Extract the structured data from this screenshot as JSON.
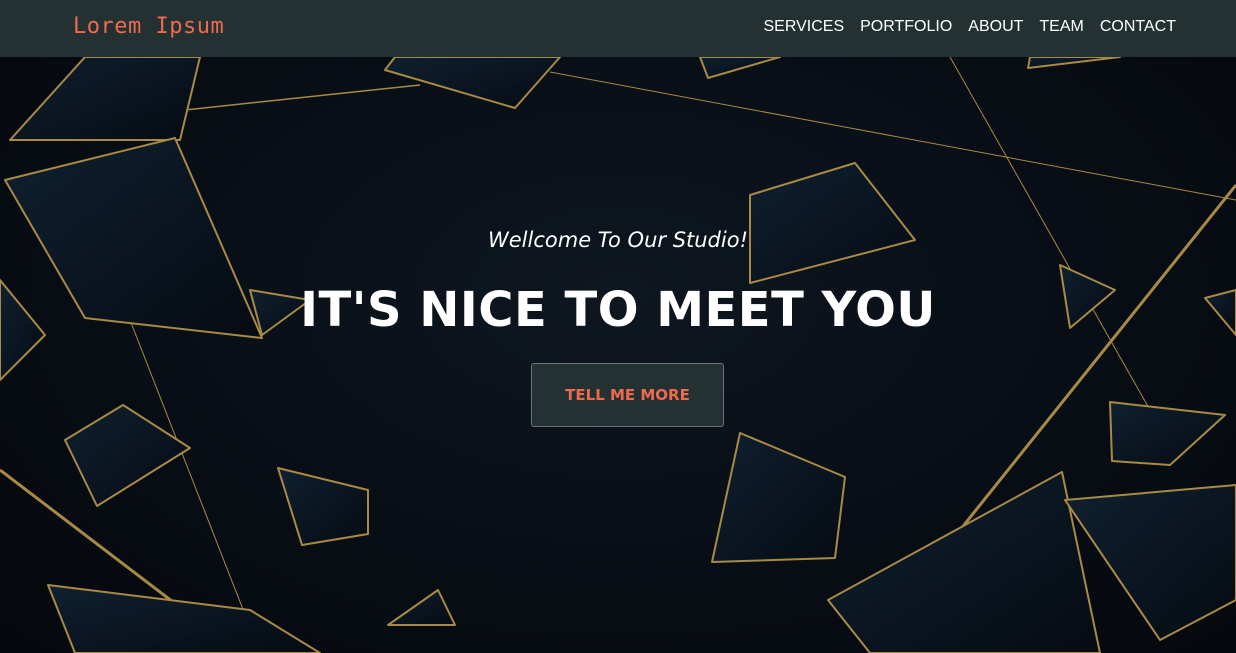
{
  "navbar": {
    "brand": "Lorem Ipsum",
    "links": [
      "SERVICES",
      "PORTFOLIO",
      "ABOUT",
      "TEAM",
      "CONTACT"
    ]
  },
  "hero": {
    "subheading": "Wellcome To Our Studio!",
    "heading": "IT'S NICE TO MEET YOU",
    "cta_label": "TELL ME MORE"
  },
  "colors": {
    "navbar_bg": "#243133",
    "brand": "#ee6a4d",
    "hero_bg": "#0a0f16",
    "gold": "#a88a44",
    "button_text": "#ee6a4d"
  }
}
